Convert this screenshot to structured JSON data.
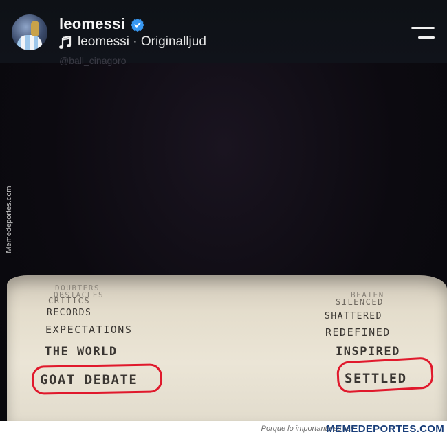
{
  "header": {
    "username": "leomessi",
    "audio_label": "leomessi · Originalljud",
    "faint_handle": "@ball_cinagoro"
  },
  "watermark_side": "Memedeportes.com",
  "receipt": {
    "top_left_faded": "DOUBTERS",
    "top_left_faded2": "OBSTACLES",
    "top_right_faded": "SILENCED",
    "top_right_faded2": "BEATEN",
    "rows": [
      {
        "left": "CRITICS",
        "right": "SILENCED"
      },
      {
        "left": "RECORDS",
        "right": "SHATTERED"
      },
      {
        "left": "EXPECTATIONS",
        "right": "REDEFINED"
      },
      {
        "left": "THE WORLD",
        "right": "INSPIRED"
      },
      {
        "left": "GOAT DEBATE",
        "right": "SETTLED"
      }
    ]
  },
  "footer": {
    "tagline": "Porque lo importante es reír",
    "brand": "MEMEDEPORTES.COM"
  },
  "colors": {
    "highlight_circle": "#e0192c",
    "verified_badge": "#3897f0"
  },
  "icons": [
    "verified-icon",
    "music-note-icon",
    "menu-icon"
  ]
}
